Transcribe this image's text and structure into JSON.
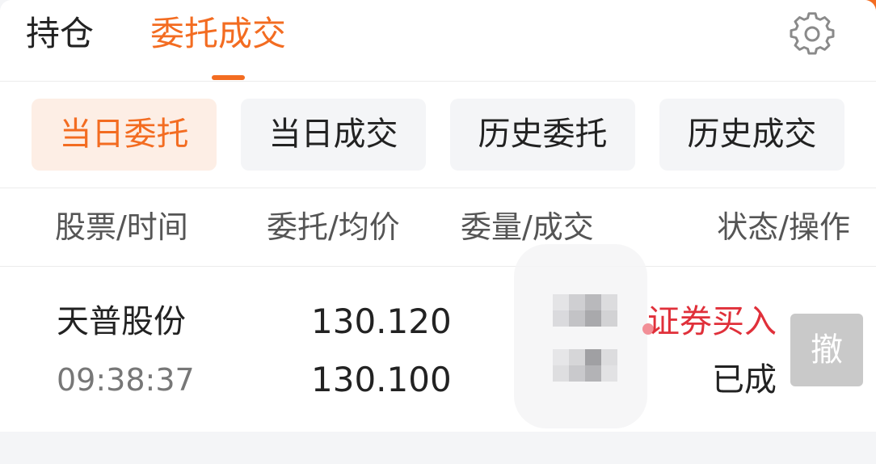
{
  "top_tabs": [
    {
      "label": "持仓",
      "active": false
    },
    {
      "label": "委托成交",
      "active": true
    }
  ],
  "settings_icon": "gear-icon",
  "filters": [
    {
      "label": "当日委托",
      "active": true
    },
    {
      "label": "当日成交",
      "active": false
    },
    {
      "label": "历史委托",
      "active": false
    },
    {
      "label": "历史成交",
      "active": false
    }
  ],
  "table_header": {
    "col1": "股票/时间",
    "col2": "委托/均价",
    "col3": "委量/成交",
    "col4": "状态/操作"
  },
  "orders": [
    {
      "name": "天普股份",
      "time": "09:38:37",
      "order_price": "130.120",
      "avg_price": "130.100",
      "type": "证券买入",
      "status": "已成",
      "cancel_label": "撤"
    }
  ],
  "colors": {
    "accent": "#f36c21",
    "active_bg": "#fdeee5",
    "buy_red": "#e0303a",
    "disabled_btn": "#c9c9c9"
  }
}
